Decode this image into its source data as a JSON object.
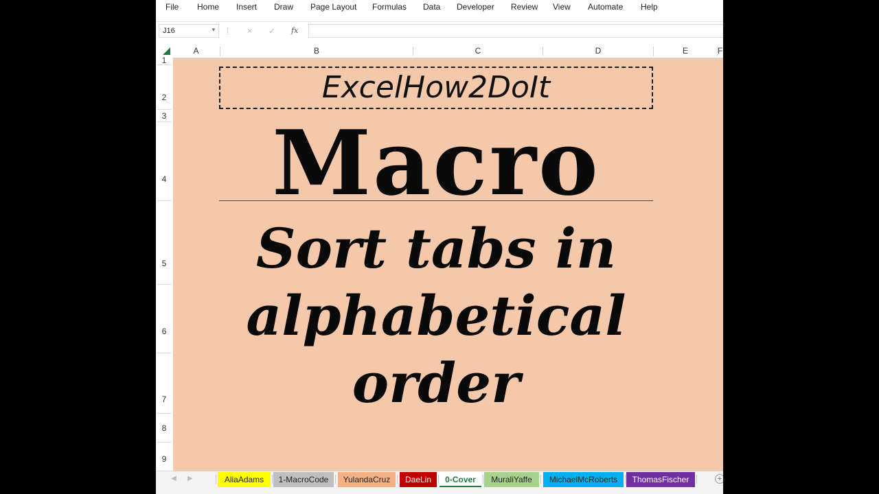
{
  "menu": [
    "File",
    "Home",
    "Insert",
    "Draw",
    "Page Layout",
    "Formulas",
    "Data",
    "Developer",
    "Review",
    "View",
    "Automate",
    "Help"
  ],
  "formula_bar": {
    "name_box": "J16",
    "cancel_icon": "×",
    "enter_icon": "✓",
    "function_icon": "fx",
    "value": ""
  },
  "columns": [
    "A",
    "B",
    "C",
    "D",
    "E",
    "F"
  ],
  "rows": [
    "1",
    "2",
    "3",
    "4",
    "5",
    "6",
    "7",
    "8",
    "9"
  ],
  "content": {
    "brand": "ExcelHow2DoIt",
    "title": "Macro",
    "subtitle_lines": [
      "Sort tabs in",
      "alphabetical",
      "order"
    ]
  },
  "sheet_tabs": [
    {
      "label": "AliaAdams",
      "color": "#ffff00"
    },
    {
      "label": "1-MacroCode",
      "color": "#bfbfbf"
    },
    {
      "label": "YulandaCruz",
      "color": "#f4b183"
    },
    {
      "label": "DaeLin",
      "color": "#c00000"
    },
    {
      "label": "0-Cover",
      "color": "#ffffff",
      "active": true
    },
    {
      "label": "MuraliYaffe",
      "color": "#a9d18e"
    },
    {
      "label": "MichaelMcRoberts",
      "color": "#00b0f0"
    },
    {
      "label": "ThomasFischer",
      "color": "#7030a0"
    }
  ],
  "colors": {
    "sheet_fill": "#f4c8ab",
    "accent": "#1f7a3c"
  }
}
